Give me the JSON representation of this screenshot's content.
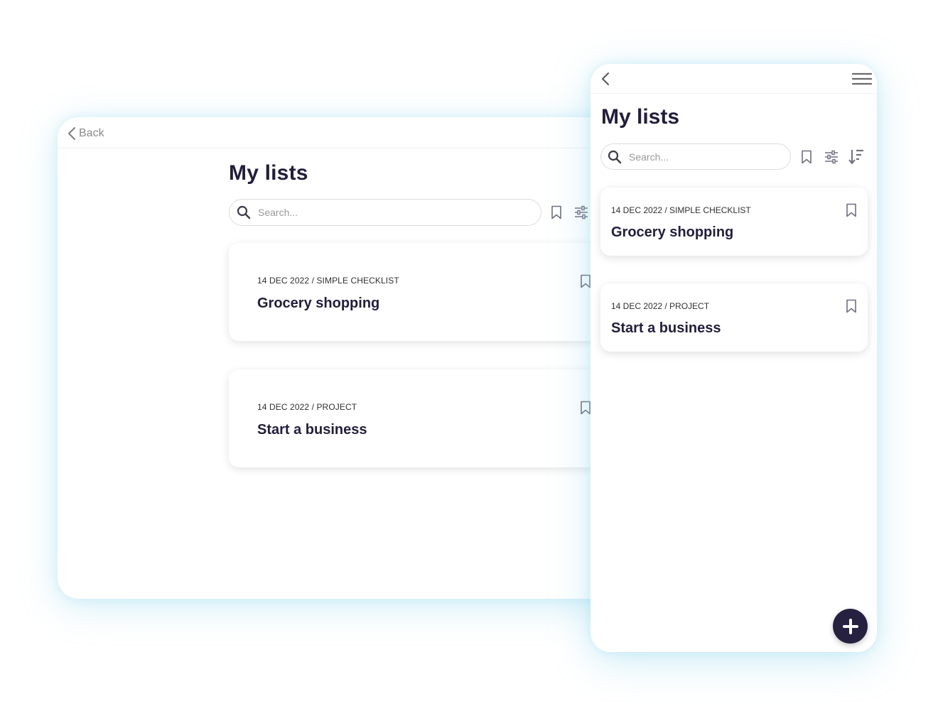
{
  "desktop": {
    "back_label": "Back",
    "title": "My lists",
    "search": {
      "placeholder": "Search..."
    },
    "cards": [
      {
        "meta": "14 DEC 2022 / SIMPLE CHECKLIST",
        "title": "Grocery shopping"
      },
      {
        "meta": "14 DEC 2022 / PROJECT",
        "title": "Start a business"
      }
    ]
  },
  "mobile": {
    "title": "My lists",
    "search": {
      "placeholder": "Search..."
    },
    "cards": [
      {
        "meta": "14 DEC 2022 / SIMPLE CHECKLIST",
        "title": "Grocery shopping"
      },
      {
        "meta": "14 DEC 2022 / PROJECT",
        "title": "Start a business"
      }
    ],
    "fab_icon": "plus-icon"
  },
  "icons": {
    "back": "chevron-left-icon",
    "menu": "hamburger-menu-icon",
    "search": "search-icon",
    "bookmark": "bookmark-icon",
    "filter": "sliders-icon",
    "sort": "sort-icon"
  },
  "colors": {
    "accent_dark": "#262140",
    "title_text": "#231d3b",
    "glow": "#78cdeb",
    "muted_text": "#8a8a8a"
  }
}
